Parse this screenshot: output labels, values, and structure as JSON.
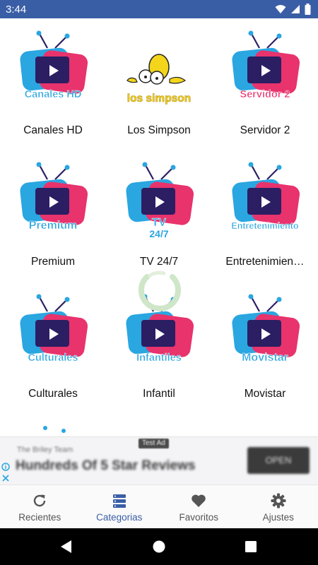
{
  "status_bar": {
    "time": "3:44",
    "icons": [
      "wifi-icon",
      "signal-icon",
      "battery-icon"
    ]
  },
  "grid": {
    "items": [
      {
        "label": "Canales HD",
        "logo_text": "Canales HD",
        "text_color": "#2aa6e0",
        "logo": "tv"
      },
      {
        "label": "Los Simpson",
        "logo_text": "los simpson",
        "text_color": "#f3d51c",
        "logo": "simpsons"
      },
      {
        "label": "Servidor 2",
        "logo_text": "Servidor 2",
        "text_color": "#e8336d",
        "logo": "tv"
      },
      {
        "label": "Premium",
        "logo_text": "Premium",
        "text_color": "#2aa6e0",
        "logo": "tv"
      },
      {
        "label": "TV 24/7",
        "logo_text": "TV",
        "logo_text2": "24/7",
        "text_color": "#2aa6e0",
        "logo": "tv"
      },
      {
        "label": "Entretenimien…",
        "logo_text": "Entretenimiento",
        "text_color": "#2aa6e0",
        "logo": "tv"
      },
      {
        "label": "Culturales",
        "logo_text": "Culturales",
        "text_color": "#2aa6e0",
        "logo": "tv"
      },
      {
        "label": "Infantil",
        "logo_text": "Infantiles",
        "text_color": "#2aa6e0",
        "logo": "tv"
      },
      {
        "label": "Movistar",
        "logo_text": "Movistar",
        "text_color": "#2aa6e0",
        "logo": "tv"
      }
    ]
  },
  "ad": {
    "tag": "Test Ad",
    "advertiser": "The Briley Team",
    "headline": "Hundreds Of 5 Star Reviews",
    "cta": "OPEN"
  },
  "bottom_nav": {
    "items": [
      {
        "label": "Recientes",
        "icon": "refresh-icon",
        "active": false
      },
      {
        "label": "Categorias",
        "icon": "categories-icon",
        "active": true
      },
      {
        "label": "Favoritos",
        "icon": "heart-icon",
        "active": false
      },
      {
        "label": "Ajustes",
        "icon": "gear-icon",
        "active": false
      }
    ]
  },
  "colors": {
    "accent": "#3a5ea6",
    "tv_blue": "#2aa6e0",
    "tv_pink": "#e8336d",
    "tv_screen": "#2b1e63"
  }
}
